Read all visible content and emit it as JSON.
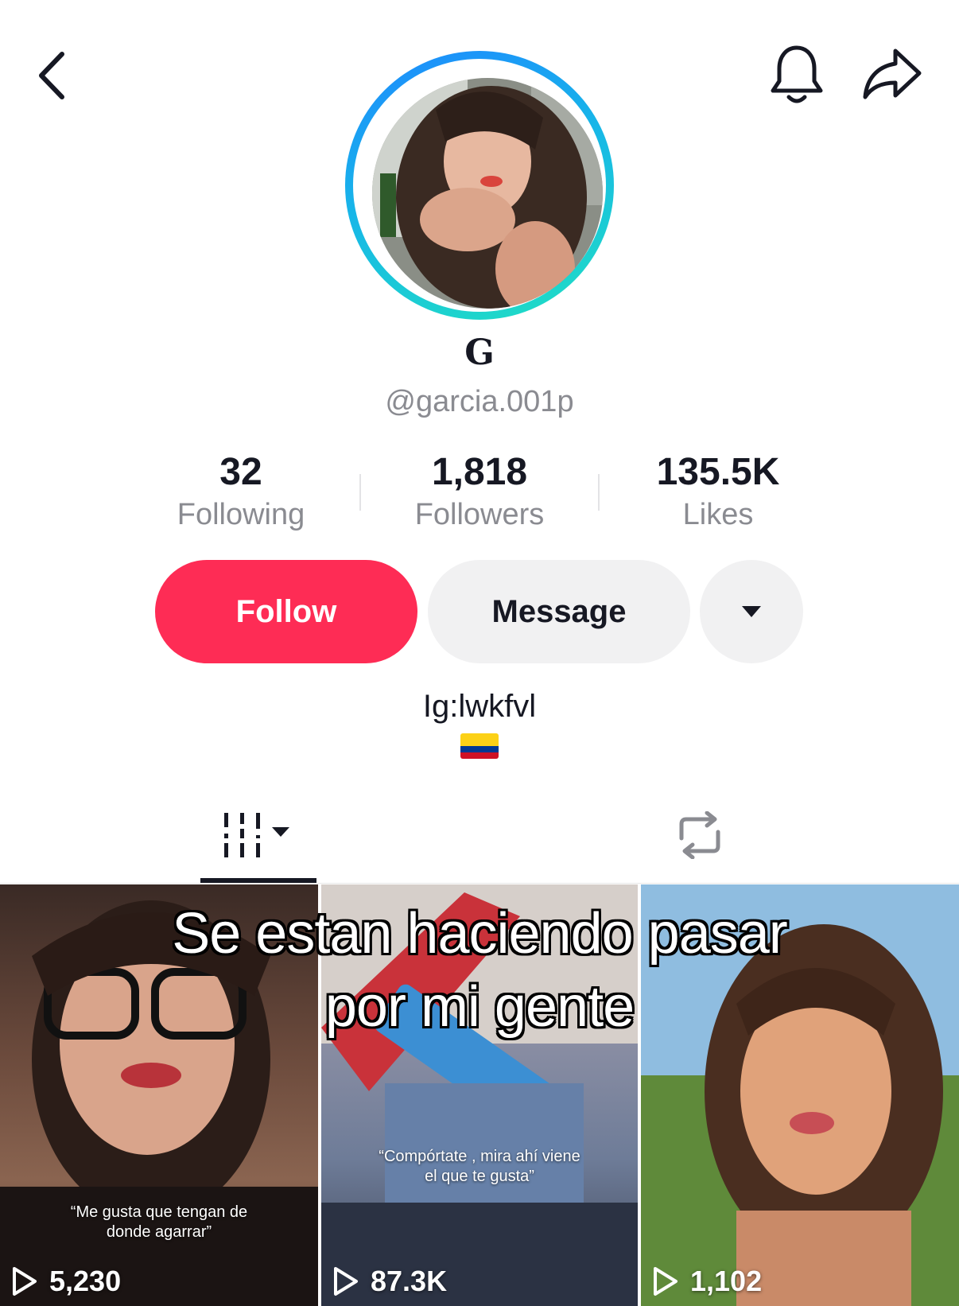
{
  "profile": {
    "display_name": "G",
    "handle": "@garcia.001p",
    "bio": "Ig:lwkfvl",
    "flag_icon": "colombia-flag"
  },
  "stats": [
    {
      "value": "32",
      "label": "Following"
    },
    {
      "value": "1,818",
      "label": "Followers"
    },
    {
      "value": "135.5K",
      "label": "Likes"
    }
  ],
  "actions": {
    "follow_label": "Follow",
    "message_label": "Message",
    "more_icon": "caret-down-icon"
  },
  "colors": {
    "follow": "#fe2c55",
    "ring_start": "#1e88ff",
    "ring_end": "#20e0c2"
  },
  "tabs": [
    {
      "icon": "videos-grid-icon",
      "active": true
    },
    {
      "icon": "repost-icon",
      "active": false
    }
  ],
  "overlay": {
    "line1": "Se estan haciendo pasar",
    "line2": "por mi gente"
  },
  "videos": [
    {
      "caption_line1": "“Me gusta que tengan de",
      "caption_line2": "donde agarrar”",
      "views": "5,230"
    },
    {
      "caption_line1": "“Compórtate , mira ahí viene",
      "caption_line2": "el que te gusta”",
      "views": "87.3K"
    },
    {
      "caption_line1": "",
      "caption_line2": "",
      "views": "1,102"
    }
  ]
}
